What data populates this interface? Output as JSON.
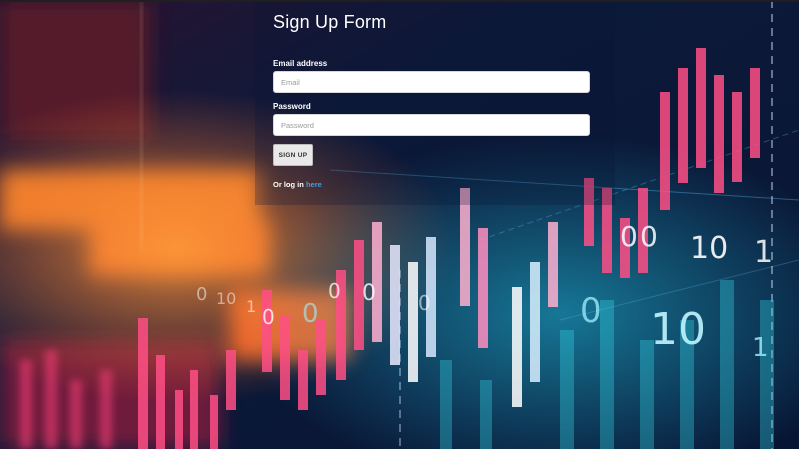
{
  "form": {
    "title": "Sign Up Form",
    "email_label": "Email address",
    "email_placeholder": "Email",
    "email_value": "",
    "password_label": "Password",
    "password_placeholder": "Password",
    "password_value": "",
    "submit_label": "SIGN UP",
    "login_prefix": "Or log in",
    "login_link": "here"
  },
  "background": {
    "digits": [
      "0",
      "10",
      "1",
      "0",
      "0",
      "10",
      "1",
      "0",
      "0",
      "10",
      "1",
      "10",
      "11",
      "0"
    ],
    "colors": {
      "base": "#0a1633",
      "pink": "#ff4f86",
      "orange": "#ff8a2a",
      "cyan": "#35d6e8",
      "white": "#ffffff"
    }
  },
  "colors": {
    "link": "#3aa0e8",
    "button_bg": "#e9e9e9"
  }
}
